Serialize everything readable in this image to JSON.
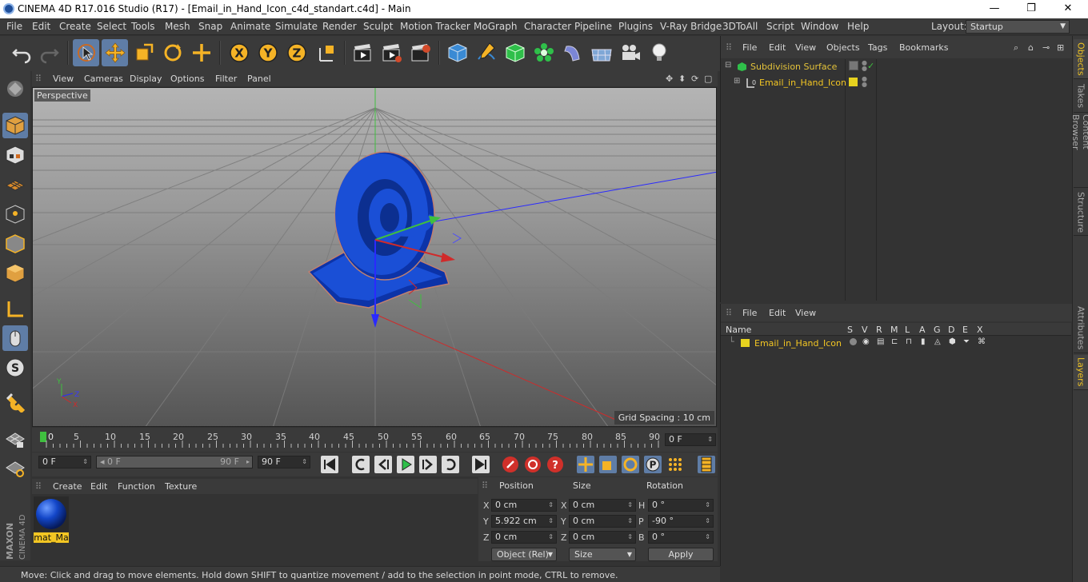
{
  "window": {
    "title": "CINEMA 4D R17.016 Studio (R17) - [Email_in_Hand_Icon_c4d_standart.c4d] - Main",
    "controls": [
      "—",
      "❐",
      "✕"
    ]
  },
  "menubar": {
    "items": [
      "File",
      "Edit",
      "Create",
      "Select",
      "Tools",
      "Mesh",
      "Snap",
      "Animate",
      "Simulate",
      "Render",
      "Sculpt",
      "Motion Tracker",
      "MoGraph",
      "Character",
      "Pipeline",
      "Plugins",
      "V-Ray Bridge",
      "3DToAll",
      "Script",
      "Window",
      "Help"
    ],
    "layout_label": "Layout:",
    "layout_value": "Startup"
  },
  "toolbar": {
    "axis_x": "X",
    "axis_y": "Y",
    "axis_z": "Z"
  },
  "viewport": {
    "menu": [
      "View",
      "Cameras",
      "Display",
      "Options",
      "Filter",
      "Panel"
    ],
    "label": "Perspective",
    "grid_spacing": "Grid Spacing : 10 cm",
    "axis_labels": {
      "y": "Y",
      "z": "Z",
      "x": "X"
    }
  },
  "timeline": {
    "ticks": [
      "0",
      "5",
      "10",
      "15",
      "20",
      "25",
      "30",
      "35",
      "40",
      "45",
      "50",
      "55",
      "60",
      "65",
      "70",
      "75",
      "80",
      "85",
      "90"
    ],
    "current_frame": "0 F"
  },
  "transport": {
    "start": "0 F",
    "range_start": "0 F",
    "range_end": "90 F",
    "end": "90 F"
  },
  "materials": {
    "menu": [
      "Create",
      "Edit",
      "Function",
      "Texture"
    ],
    "items": [
      {
        "name": "mat_Ma"
      }
    ]
  },
  "coordinates": {
    "headers": [
      "Position",
      "Size",
      "Rotation"
    ],
    "rows": [
      {
        "pl": "X",
        "pv": "0 cm",
        "sl": "X",
        "sv": "0 cm",
        "rl": "H",
        "rv": "0 °"
      },
      {
        "pl": "Y",
        "pv": "5.922 cm",
        "sl": "Y",
        "sv": "0 cm",
        "rl": "P",
        "rv": "-90 °"
      },
      {
        "pl": "Z",
        "pv": "0 cm",
        "sl": "Z",
        "sv": "0 cm",
        "rl": "B",
        "rv": "0 °"
      }
    ],
    "mode": "Object (Rel)",
    "size_mode": "Size",
    "apply": "Apply"
  },
  "status": "Move: Click and drag to move elements. Hold down SHIFT to quantize movement / add to the selection in point mode, CTRL to remove.",
  "objects_panel": {
    "menu": [
      "File",
      "Edit",
      "View",
      "Objects",
      "Tags",
      "Bookmarks"
    ],
    "tree": [
      {
        "name": "Subdivision Surface"
      },
      {
        "name": "Email_in_Hand_Icon"
      }
    ]
  },
  "layers_panel": {
    "menu": [
      "File",
      "Edit",
      "View"
    ],
    "columns": [
      "Name",
      "S",
      "V",
      "R",
      "M",
      "L",
      "A",
      "G",
      "D",
      "E",
      "X"
    ],
    "rows": [
      {
        "name": "Email_in_Hand_Icon",
        "color": "#e6d21f"
      }
    ]
  },
  "right_tabs": [
    "Objects",
    "Takes",
    "Content Browser",
    "Structure",
    "Attributes",
    "Layers"
  ],
  "colors": {
    "accent": "#5f7da6",
    "object_name": "#f3c623",
    "model_blue": "#1346c8"
  }
}
